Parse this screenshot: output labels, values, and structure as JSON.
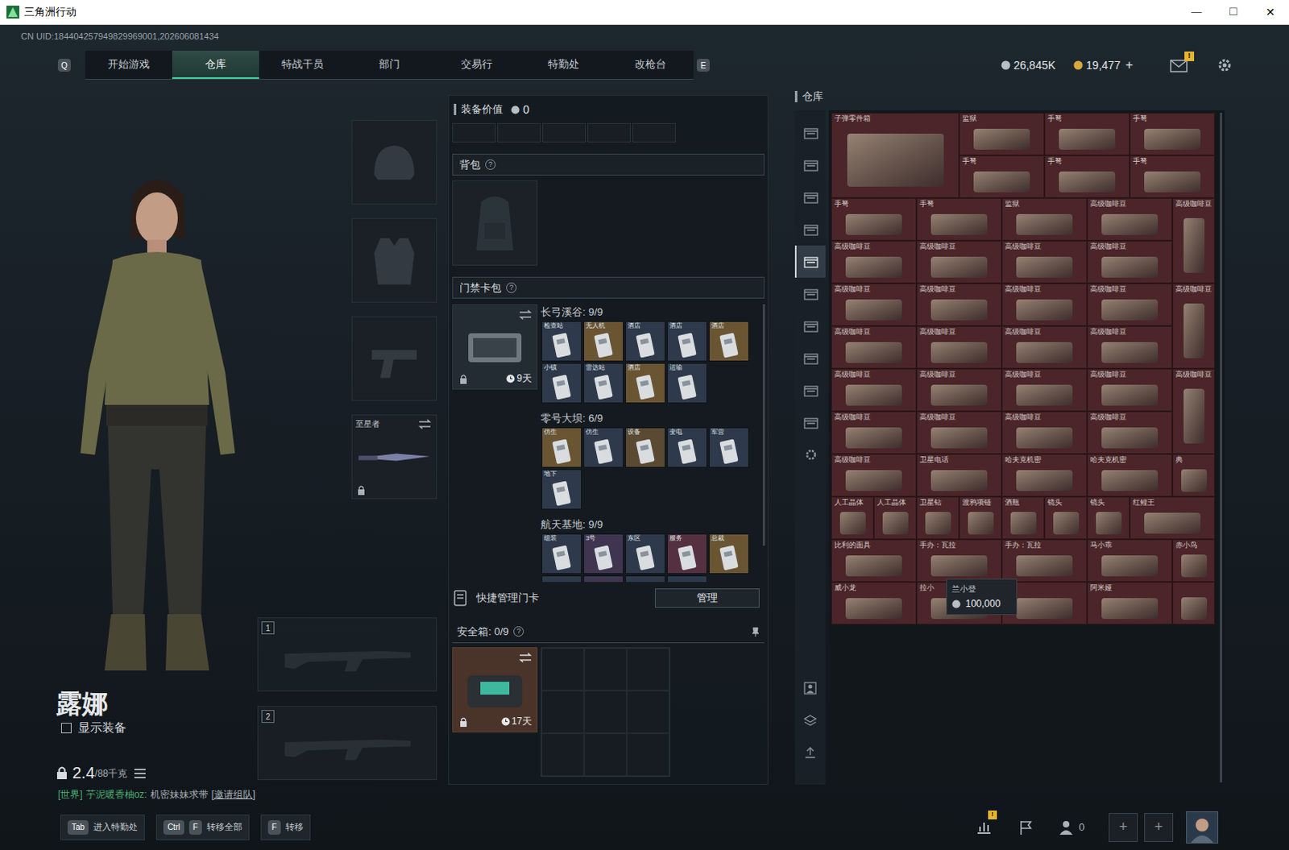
{
  "window": {
    "title": "三角洲行动",
    "controls": [
      "—",
      "☐",
      "✕"
    ]
  },
  "uid": "CN UID:184404257949829969001,202606081434",
  "nav": {
    "prev_key": "Q",
    "next_key": "E",
    "tabs": [
      {
        "label": "开始游戏",
        "selected": false
      },
      {
        "label": "仓库",
        "selected": true
      },
      {
        "label": "特战干员",
        "selected": false
      },
      {
        "label": "部门",
        "selected": false
      },
      {
        "label": "交易行",
        "selected": false
      },
      {
        "label": "特勤处",
        "selected": false
      },
      {
        "label": "改枪台",
        "selected": false
      }
    ]
  },
  "currency": {
    "silver": "26,845K",
    "gold": "19,477",
    "add": "+"
  },
  "mail": {
    "badge": "!"
  },
  "character": {
    "name": "露娜",
    "show_gear": {
      "label": "显示装备",
      "checked": false
    },
    "weight": "2.4",
    "weight_max": "/88千克"
  },
  "chat": {
    "channel": "[世界]",
    "sender": "芋泥暖香柚oz:",
    "message": "机密妹妹求带",
    "action": "[邀请组队]"
  },
  "equipment": {
    "slots": [
      {
        "kind": "helmet"
      },
      {
        "kind": "armor"
      },
      {
        "kind": "pistol"
      },
      {
        "kind": "melee",
        "label": "至星者",
        "locked": true
      }
    ],
    "weapons": [
      {
        "number": "1"
      },
      {
        "number": "2"
      }
    ]
  },
  "loadout": {
    "value_label": "装备价值",
    "value": "0",
    "backpack": {
      "title": "背包",
      "help": "?"
    },
    "keycards": {
      "title": "门禁卡包",
      "help": "?",
      "days": "9天",
      "locked": true,
      "maps": [
        {
          "name": "长弓溪谷: 9/9",
          "cards": [
            {
              "label": "检查站",
              "color": "#2e394b"
            },
            {
              "label": "无人机",
              "color": "#6a5533"
            },
            {
              "label": "酒店",
              "color": "#2e394b"
            },
            {
              "label": "酒店",
              "color": "#2e394b"
            },
            {
              "label": "酒店",
              "color": "#6a5533"
            },
            {
              "label": "小镇",
              "color": "#2e394b"
            },
            {
              "label": "雷达站",
              "color": "#2e394b"
            },
            {
              "label": "酒店",
              "color": "#6a5533"
            },
            {
              "label": "运输",
              "color": "#2e394b"
            }
          ]
        },
        {
          "name": "零号大坝: 6/9",
          "cards": [
            {
              "label": "仿生",
              "color": "#6a5533"
            },
            {
              "label": "仿生",
              "color": "#2e394b"
            },
            {
              "label": "设备",
              "color": "#5a4a34"
            },
            {
              "label": "变电",
              "color": "#2e394b"
            },
            {
              "label": "军营",
              "color": "#2e394b"
            },
            {
              "label": "地下",
              "color": "#2e394b"
            }
          ]
        },
        {
          "name": "航天基地: 9/9",
          "cards": [
            {
              "label": "组装",
              "color": "#2e394b"
            },
            {
              "label": "3号",
              "color": "#3f3550"
            },
            {
              "label": "东区",
              "color": "#2e394b"
            },
            {
              "label": "服务",
              "color": "#553040"
            },
            {
              "label": "总裁",
              "color": "#6a5533"
            },
            {
              "color": "#2e394b"
            },
            {
              "color": "#3f3550"
            },
            {
              "color": "#2e394b"
            },
            {
              "color": "#2e394b"
            }
          ]
        }
      ]
    },
    "quick_manage": {
      "label": "快捷管理门卡",
      "button": "管理"
    },
    "safe": {
      "title": "安全箱: 0/9",
      "help": "?",
      "days": "17天",
      "locked": true
    }
  },
  "warehouse": {
    "title": "仓库",
    "side_tabs": [
      {
        "selected": false
      },
      {
        "selected": false
      },
      {
        "selected": false
      },
      {
        "selected": false
      },
      {
        "selected": true
      },
      {
        "selected": false
      },
      {
        "selected": false
      },
      {
        "selected": false
      },
      {
        "selected": false
      },
      {
        "selected": false
      },
      {
        "selected": false
      }
    ],
    "items": [
      {
        "kind": "large",
        "label": "子弹零件箱"
      },
      {
        "kind": "wide",
        "label": "监狱"
      },
      {
        "kind": "wide",
        "label": "手弩"
      },
      {
        "kind": "wide",
        "label": "手弩"
      },
      {
        "kind": "wide",
        "label": "手弩"
      },
      {
        "kind": "wide",
        "label": "手弩"
      },
      {
        "kind": "wide",
        "label": "手弩"
      },
      {
        "kind": "wide",
        "label": "手弩"
      },
      {
        "kind": "wide",
        "label": "手弩"
      },
      {
        "kind": "wide",
        "label": "监狱"
      },
      {
        "kind": "wide",
        "label": "高级咖啡豆"
      },
      {
        "kind": "tall",
        "label": "高级咖啡豆"
      },
      {
        "kind": "wide",
        "label": "高级咖啡豆"
      },
      {
        "kind": "wide",
        "label": "高级咖啡豆"
      },
      {
        "kind": "wide",
        "label": "高级咖啡豆"
      },
      {
        "kind": "wide",
        "label": "高级咖啡豆"
      },
      {
        "kind": "wide",
        "label": "高级咖啡豆"
      },
      {
        "kind": "wide",
        "label": "高级咖啡豆"
      },
      {
        "kind": "wide",
        "label": "高级咖啡豆"
      },
      {
        "kind": "wide",
        "label": "高级咖啡豆"
      },
      {
        "kind": "tall",
        "label": "高级咖啡豆"
      },
      {
        "kind": "wide",
        "label": "高级咖啡豆"
      },
      {
        "kind": "wide",
        "label": "高级咖啡豆"
      },
      {
        "kind": "wide",
        "label": "高级咖啡豆"
      },
      {
        "kind": "wide",
        "label": "高级咖啡豆"
      },
      {
        "kind": "wide",
        "label": "高级咖啡豆"
      },
      {
        "kind": "wide",
        "label": "高级咖啡豆"
      },
      {
        "kind": "wide",
        "label": "高级咖啡豆"
      },
      {
        "kind": "wide",
        "label": "高级咖啡豆"
      },
      {
        "kind": "tall",
        "label": "高级咖啡豆"
      },
      {
        "kind": "wide",
        "label": "高级咖啡豆"
      },
      {
        "kind": "wide",
        "label": "高级咖啡豆"
      },
      {
        "kind": "wide",
        "label": "高级咖啡豆"
      },
      {
        "kind": "wide",
        "label": "高级咖啡豆"
      },
      {
        "kind": "wide",
        "label": "高级咖啡豆"
      },
      {
        "kind": "wide",
        "label": "卫星电话"
      },
      {
        "kind": "wide",
        "label": "哈夫克机密"
      },
      {
        "kind": "wide",
        "label": "哈夫克机密"
      },
      {
        "kind": "small",
        "label": "典"
      },
      {
        "kind": "small",
        "label": "人工晶体"
      },
      {
        "kind": "small",
        "label": "人工晶体"
      },
      {
        "kind": "small",
        "label": "卫星钻"
      },
      {
        "kind": "small",
        "label": "渡鸦项链"
      },
      {
        "kind": "small",
        "label": "酒瓶"
      },
      {
        "kind": "small",
        "label": "镜头"
      },
      {
        "kind": "small",
        "label": "镜头"
      },
      {
        "kind": "wide",
        "label": "红鲤王"
      },
      {
        "kind": "wide",
        "label": "比利的面具"
      },
      {
        "kind": "wide",
        "label": "手办：瓦拉"
      },
      {
        "kind": "wide",
        "label": "手办：瓦拉"
      },
      {
        "kind": "wide",
        "label": "马小乖"
      },
      {
        "kind": "small",
        "label": "赤小鸟"
      },
      {
        "kind": "wide",
        "label": "威小龙"
      },
      {
        "kind": "wide",
        "label": "拉小"
      },
      {
        "kind": "wide"
      },
      {
        "kind": "wide",
        "label": "阿米娅"
      },
      {
        "kind": "small"
      }
    ],
    "tooltip": {
      "name": "兰小登",
      "price": "100,000"
    }
  },
  "hints": [
    {
      "keys": [
        "Tab"
      ],
      "label": "进入特勤处"
    },
    {
      "keys": [
        "Ctrl",
        "F"
      ],
      "label": "转移全部"
    },
    {
      "keys": [
        "F"
      ],
      "label": "转移"
    }
  ],
  "footer": {
    "stats_badge": "!",
    "friends": "0",
    "slots": [
      "+",
      "+"
    ]
  }
}
